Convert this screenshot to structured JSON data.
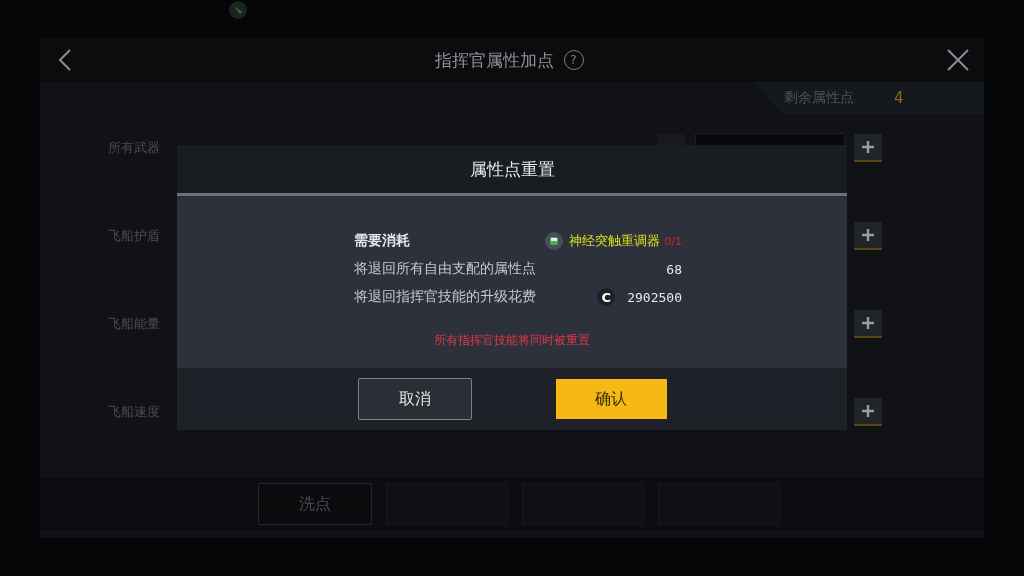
{
  "header": {
    "title": "指挥官属性加点",
    "help": "?"
  },
  "remaining": {
    "label": "剩余属性点",
    "value": "4"
  },
  "rows": [
    {
      "label": "所有武器"
    },
    {
      "label": "飞船护盾"
    },
    {
      "label": "飞船能量"
    },
    {
      "label": "飞船速度"
    }
  ],
  "bottom": {
    "reset_button": "洗点"
  },
  "dialog": {
    "title": "属性点重置",
    "cost_label": "需要消耗",
    "item_name": "神经突触重调器",
    "item_count": "0/1",
    "lines": [
      {
        "label": "将退回所有自由支配的属性点",
        "value": "68",
        "currency": false
      },
      {
        "label": "将退回指挥官技能的升级花费",
        "value": "2902500",
        "currency": true,
        "currency_symbol": "C"
      }
    ],
    "warning": "所有指挥官技能将同时被重置",
    "cancel": "取消",
    "confirm": "确认"
  }
}
